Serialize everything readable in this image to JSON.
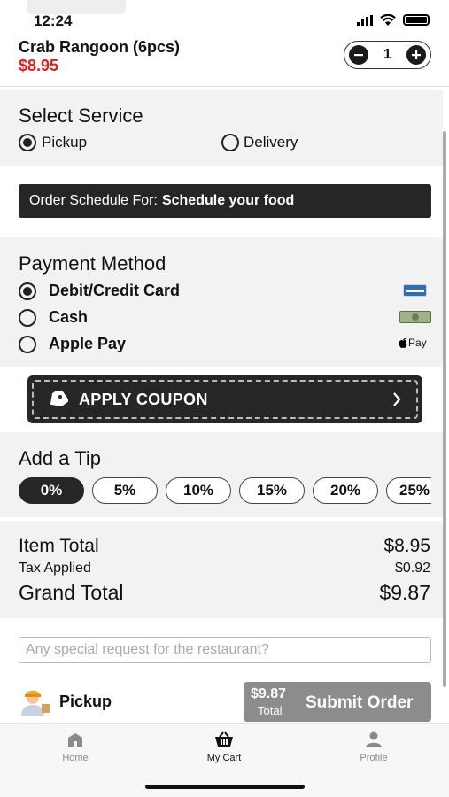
{
  "status_bar": {
    "time": "12:24"
  },
  "cart_item": {
    "name": "Crab Rangoon (6pcs)",
    "price": "$8.95",
    "quantity": "1"
  },
  "service": {
    "title": "Select Service",
    "options": [
      {
        "label": "Pickup",
        "selected": true
      },
      {
        "label": "Delivery",
        "selected": false
      }
    ]
  },
  "schedule": {
    "prefix": "Order Schedule For:",
    "value": "Schedule your food"
  },
  "payment": {
    "title": "Payment Method",
    "options": [
      {
        "label": "Debit/Credit Card",
        "selected": true,
        "icon": "credit-card-icon"
      },
      {
        "label": "Cash",
        "selected": false,
        "icon": "cash-icon"
      },
      {
        "label": "Apple Pay",
        "selected": false,
        "icon": "apple-pay-icon",
        "badge": "Pay"
      }
    ]
  },
  "coupon": {
    "label": "APPLY COUPON"
  },
  "tip": {
    "title": "Add a Tip",
    "options": [
      "0%",
      "5%",
      "10%",
      "15%",
      "20%",
      "25%"
    ],
    "selected": "0%"
  },
  "totals": {
    "item_total_label": "Item Total",
    "item_total": "$8.95",
    "tax_label": "Tax Applied",
    "tax": "$0.92",
    "grand_total_label": "Grand Total",
    "grand_total": "$9.87"
  },
  "request": {
    "placeholder": "Any special request for the restaurant?"
  },
  "footer": {
    "mode": "Pickup",
    "submit_price": "$9.87",
    "submit_total_label": "Total",
    "submit_label": "Submit Order"
  },
  "tabs": [
    {
      "label": "Home",
      "icon": "home-icon",
      "active": false
    },
    {
      "label": "My Cart",
      "icon": "basket-icon",
      "active": true
    },
    {
      "label": "Profile",
      "icon": "person-icon",
      "active": false
    }
  ],
  "colors": {
    "price_red": "#e02020",
    "dark": "#262626",
    "submit_gray": "#8c8c8c",
    "section_gray": "#f2f2f2"
  }
}
